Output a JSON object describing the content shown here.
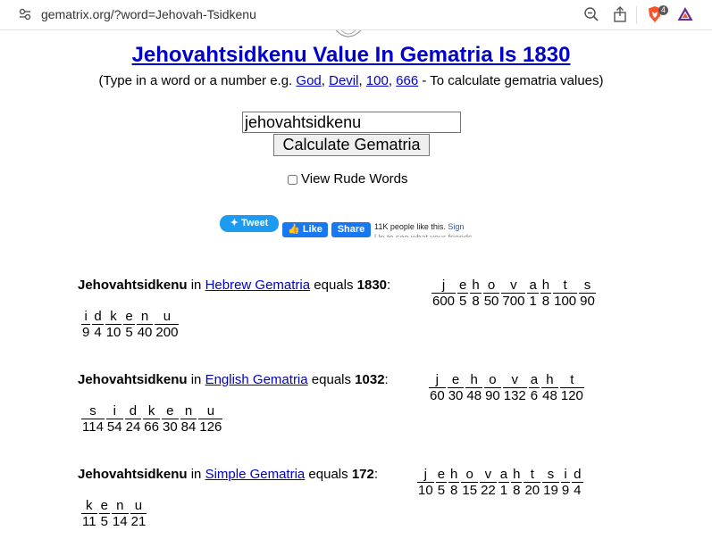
{
  "browser": {
    "url": "gematrix.org/?word=Jehovah-Tsidkenu",
    "badge_count": "4"
  },
  "page": {
    "title": "Jehovahtsidkenu Value In Gematria Is 1830",
    "subtitle_prefix": "(Type in a word or a number e.g. ",
    "examples": [
      "God",
      "Devil",
      "100",
      "666"
    ],
    "subtitle_suffix": " - To calculate gematria values)",
    "input_value": "jehovahtsidkenu",
    "calculate_label": "Calculate Gematria",
    "rude_label": "View Rude Words",
    "rude_checked": false
  },
  "social": {
    "tweet_label": "Tweet",
    "like_label": "Like",
    "share_label": "Share",
    "like_count_text": "11K people like this.",
    "sign_text": "Sign",
    "clipped_text": "Up to see what your friends"
  },
  "rows": [
    {
      "word": "Jehovahtsidkenu",
      "in_text": " in ",
      "system": "Hebrew Gematria",
      "equals_text": " equals ",
      "total": "1830",
      "line1": [
        [
          "j",
          "600"
        ],
        [
          "e",
          "5"
        ],
        [
          "h",
          "8"
        ],
        [
          "o",
          "50"
        ],
        [
          "v",
          "700"
        ],
        [
          "a",
          "1"
        ],
        [
          "h",
          "8"
        ],
        [
          "t",
          "100"
        ],
        [
          "s",
          "90"
        ]
      ],
      "line2": [
        [
          "i",
          "9"
        ],
        [
          "d",
          "4"
        ],
        [
          "k",
          "10"
        ],
        [
          "e",
          "5"
        ],
        [
          "n",
          "40"
        ],
        [
          "u",
          "200"
        ]
      ]
    },
    {
      "word": "Jehovahtsidkenu",
      "in_text": " in ",
      "system": "English Gematria",
      "equals_text": " equals ",
      "total": "1032",
      "line1": [
        [
          "j",
          "60"
        ],
        [
          "e",
          "30"
        ],
        [
          "h",
          "48"
        ],
        [
          "o",
          "90"
        ],
        [
          "v",
          "132"
        ],
        [
          "a",
          "6"
        ],
        [
          "h",
          "48"
        ],
        [
          "t",
          "120"
        ]
      ],
      "line2": [
        [
          "s",
          "114"
        ],
        [
          "i",
          "54"
        ],
        [
          "d",
          "24"
        ],
        [
          "k",
          "66"
        ],
        [
          "e",
          "30"
        ],
        [
          "n",
          "84"
        ],
        [
          "u",
          "126"
        ]
      ]
    },
    {
      "word": "Jehovahtsidkenu",
      "in_text": " in ",
      "system": "Simple Gematria",
      "equals_text": " equals ",
      "total": "172",
      "line1": [
        [
          "j",
          "10"
        ],
        [
          "e",
          "5"
        ],
        [
          "h",
          "8"
        ],
        [
          "o",
          "15"
        ],
        [
          "v",
          "22"
        ],
        [
          "a",
          "1"
        ],
        [
          "h",
          "8"
        ],
        [
          "t",
          "20"
        ],
        [
          "s",
          "19"
        ],
        [
          "i",
          "9"
        ],
        [
          "d",
          "4"
        ]
      ],
      "line2": [
        [
          "k",
          "11"
        ],
        [
          "e",
          "5"
        ],
        [
          "n",
          "14"
        ],
        [
          "u",
          "21"
        ]
      ]
    }
  ]
}
